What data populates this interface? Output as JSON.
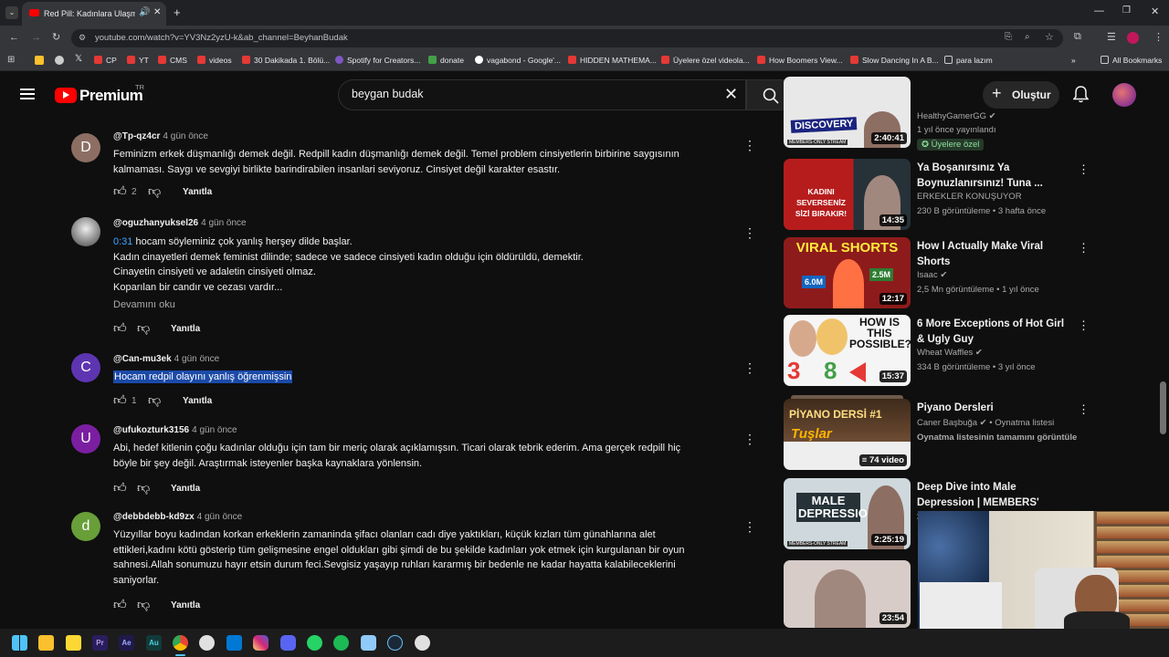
{
  "browser": {
    "tab_title": "Red Pill: Kadınlara Ulaşmak",
    "url": "youtube.com/watch?v=YV3Nz2yzU-k&ab_channel=BeyhanBudak",
    "bookmarks": [
      "CP",
      "YT",
      "CMS",
      "videos",
      "30 Dakikada 1. Bölü...",
      "Spotify for Creators...",
      "donate",
      "vagabond - Google'...",
      "HIDDEN MATHEMA...",
      "Üyelere özel videola...",
      "How Boomers View...",
      "Slow Dancing In A B...",
      "para lazım"
    ],
    "all_bookmarks": "All Bookmarks"
  },
  "header": {
    "logo": "Premium",
    "logo_badge": "TR",
    "search_value": "beygan budak",
    "create_label": "Oluştur"
  },
  "comments": [
    {
      "avatar_letter": "D",
      "avatar_color": "#8d6e63",
      "author": "@Tp-qz4cr",
      "time": "4 gün önce",
      "lines": [
        "Feminizm erkek düşmanlığı demek değil. Redpill kadın düşmanlığı demek değil. Temel problem cinsiyetlerin birbirine saygısının",
        "kalmaması. Saygı ve sevgiyi birlikte barindirabilen insanlari seviyoruz. Cinsiyet değil karakter esastır."
      ],
      "likes": "2",
      "reply": "Yanıtla"
    },
    {
      "avatar_letter": "",
      "avatar_color": "#bdbdbd",
      "author": "@oguzhanyuksel26",
      "time": "4 gün önce",
      "timestamp_link": "0:31",
      "lines": [
        " hocam söyleminiz çok yanlış herşey dilde başlar.",
        "Kadın cinayetleri demek feminist dilinde; sadece ve sadece cinsiyeti kadın olduğu için öldürüldü, demektir.",
        "Cinayetin cinsiyeti ve adaletin cinsiyeti olmaz.",
        "Koparılan bir candır ve cezası vardır..."
      ],
      "read_more": "Devamını oku",
      "likes": "",
      "reply": "Yanıtla"
    },
    {
      "avatar_letter": "C",
      "avatar_color": "#5e35b1",
      "author": "@Can-mu3ek",
      "time": "4 gün önce",
      "lines": [
        "Hocam redpil olayını yanlış öğrenmişsin"
      ],
      "likes": "1",
      "reply": "Yanıtla"
    },
    {
      "avatar_letter": "U",
      "avatar_color": "#7b1fa2",
      "author": "@ufukozturk3156",
      "time": "4 gün önce",
      "lines": [
        "Abi, hedef kitlenin çoğu kadınlar olduğu için tam bir meriç olarak açıklamışsın. Ticari olarak tebrik ederim. Ama gerçek redpill hiç",
        "böyle bir şey değil. Araştırmak isteyenler başka kaynaklara yönlensin."
      ],
      "likes": "",
      "reply": "Yanıtla"
    },
    {
      "avatar_letter": "d",
      "avatar_color": "#689f38",
      "author": "@debbdebb-kd9zx",
      "time": "4 gün önce",
      "lines": [
        "Yüzyıllar boyu kadından korkan erkeklerin zamaninda şifacı olanları cadı diye yaktıkları, küçük kızları tüm günahlarına alet",
        "ettikleri,kadını kötü gösterip tüm gelişmesine engel oldukları gibi şimdi de bu şekilde kadınları yok etmek için kurgulanan bir oyun",
        "sahnesi.Allah sonumuzu hayır etsin durum feci.Sevgisiz yaşayıp ruhları kararmış bir bedenle ne kadar hayatta kalabileceklerini",
        "saniyorlar."
      ],
      "likes": "",
      "reply": "Yanıtla"
    }
  ],
  "sidebar": [
    {
      "thumb_text": "DISCOVERY",
      "thumb_bg": "#e8e8e8",
      "badge_text": "MEMBERS-ONLY STREAM",
      "duration": "2:40:41",
      "title": "",
      "channel": "HealthyGamerGG",
      "meta": "1 yıl önce yayınlandı",
      "members": "Üyelere özel"
    },
    {
      "thumb_text": "KADINI SEVERSENİZ SİZİ BIRAKIR!",
      "thumb_bg": "#b71c1c",
      "duration": "14:35",
      "title": "Ya Boşanırsınız Ya Boynuzlanırsınız! Tuna ...",
      "channel": "ERKEKLER KONUŞUYOR",
      "meta": "230 B görüntüleme • 3 hafta önce"
    },
    {
      "thumb_text": "VIRAL SHORTS",
      "thumb_bg": "#c62828",
      "thumb_extra": [
        "6.0M",
        "2.5M"
      ],
      "duration": "12:17",
      "title": "How I Actually Make Viral Shorts",
      "channel": "Isaac",
      "meta": "2,5 Mn görüntüleme • 1 yıl önce"
    },
    {
      "thumb_text": "HOW IS THIS POSSIBLE?",
      "thumb_bg": "#f5f5f5",
      "thumb_extra": [
        "3",
        "8"
      ],
      "duration": "15:37",
      "title": "6 More Exceptions of Hot Girl & Ugly Guy",
      "channel": "Wheat Waffles",
      "meta": "334 B görüntüleme • 3 yıl önce"
    },
    {
      "thumb_text": "PİYANO DERSİ #1",
      "thumb_bg": "#3e2a1a",
      "thumb_extra": [
        "Tuşlar"
      ],
      "duration": "74 video",
      "title": "Piyano Dersleri",
      "channel": "Caner Başbuğa",
      "channel_suffix": "• Oynatma listesi",
      "meta": "Oynatma listesinin tamamını görüntüle"
    },
    {
      "thumb_text": "MALE DEPRESSION",
      "thumb_bg": "#cfd8dc",
      "badge_text": "MEMBERS-ONLY STREAM",
      "duration": "2:25:19",
      "title": "Deep Dive into Male Depression | MEMBERS' Stream",
      "channel": "",
      "meta": ""
    },
    {
      "thumb_text": "",
      "thumb_bg": "#d7ccc8",
      "duration": "23:54",
      "title": "",
      "channel": "",
      "meta": ""
    }
  ]
}
